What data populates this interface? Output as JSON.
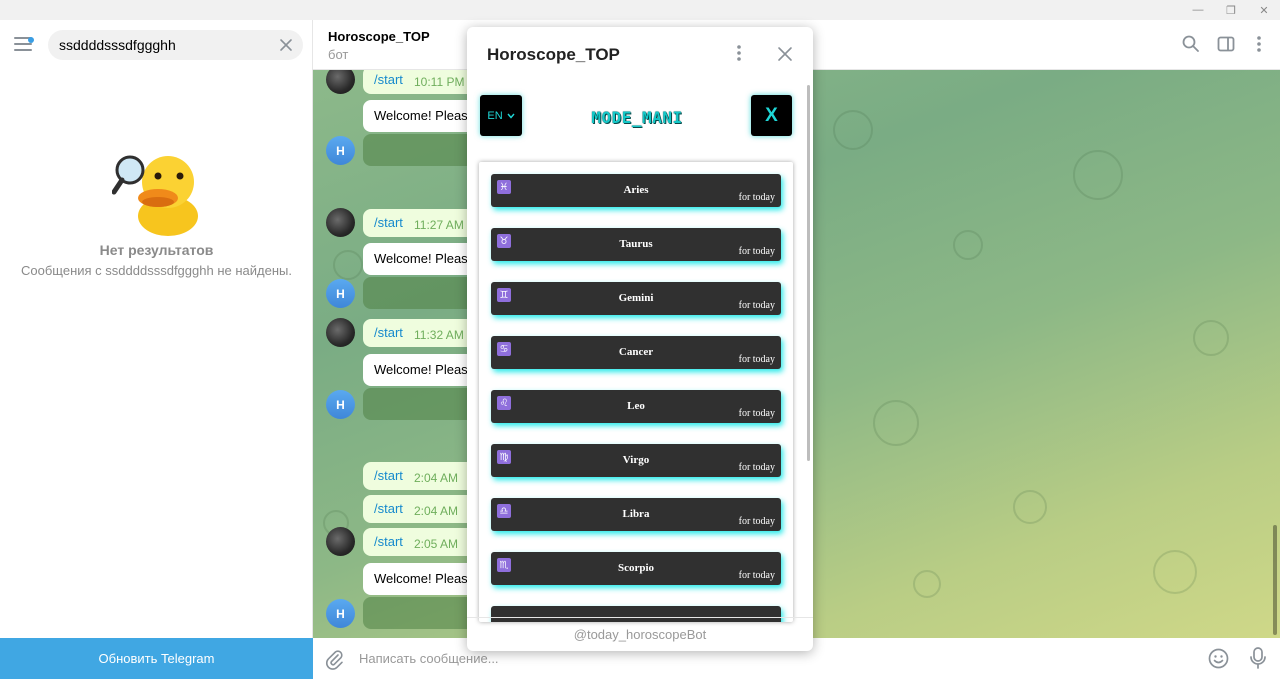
{
  "window": {
    "minimize_glyph": "—",
    "restore_glyph": "❐",
    "close_glyph": "✕"
  },
  "sidebar": {
    "search_value": "ssddddsssdfggghh",
    "no_results_title": "Нет результатов",
    "no_results_desc": "Сообщения с ssddddsssdfggghh не найдены.",
    "update_button": "Обновить Telegram"
  },
  "chat": {
    "title": "Horoscope_TOP",
    "subtitle": "бот",
    "avatar_letter": "H",
    "messages": [
      {
        "cmd": "/start",
        "time": "10:11 PM"
      },
      {
        "text": "Welcome! Please"
      },
      {
        "cmd": "/start",
        "time": "11:27 AM"
      },
      {
        "text": "Welcome! Please"
      },
      {
        "cmd": "/start",
        "time": "11:32 AM"
      },
      {
        "text": "Welcome! Please"
      },
      {
        "cmd": "/start",
        "time": "2:04 AM"
      },
      {
        "cmd": "/start",
        "time": "2:04 AM"
      },
      {
        "cmd": "/start",
        "time": "2:05 AM"
      },
      {
        "text": "Welcome! Please"
      }
    ],
    "composer_placeholder": "Написать сообщение..."
  },
  "webapp": {
    "title": "Horoscope_TOP",
    "lang": "EN",
    "brand": "MODE_MANI",
    "close_label": "X",
    "footer": "@today_horoscopeBot",
    "signs": [
      {
        "symbol": "♓",
        "name": "Aries",
        "sub": "for today"
      },
      {
        "symbol": "♉",
        "name": "Taurus",
        "sub": "for today"
      },
      {
        "symbol": "♊",
        "name": "Gemini",
        "sub": "for today"
      },
      {
        "symbol": "♋",
        "name": "Cancer",
        "sub": "for today"
      },
      {
        "symbol": "♌",
        "name": "Leo",
        "sub": "for today"
      },
      {
        "symbol": "♍",
        "name": "Virgo",
        "sub": "for today"
      },
      {
        "symbol": "♎",
        "name": "Libra",
        "sub": "for today"
      },
      {
        "symbol": "♏",
        "name": "Scorpio",
        "sub": "for today"
      }
    ]
  },
  "colors": {
    "accent": "#40a7e3",
    "cyan": "#14c8c8",
    "sign_row": "#303030"
  }
}
